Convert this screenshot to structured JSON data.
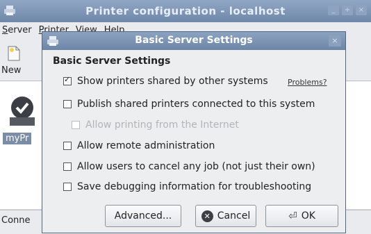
{
  "background_window": {
    "title": "Printer configuration - localhost",
    "menu": [
      "Server",
      "Printer",
      "View",
      "Help"
    ],
    "toolbar_new": "New",
    "printer_label": "myPr",
    "status": "Conne",
    "window_buttons": [
      "_",
      "+",
      "×"
    ]
  },
  "dialog": {
    "title": "Basic Server Settings",
    "close": "×",
    "heading": "Basic Server Settings",
    "options": {
      "show_shared": {
        "label": "Show printers shared by other systems",
        "checked": true
      },
      "publish": {
        "label": "Publish shared printers connected to this system",
        "checked": false
      },
      "allow_internet": {
        "label": "Allow printing from the Internet",
        "checked": false,
        "disabled": true
      },
      "remote_admin": {
        "label": "Allow remote administration",
        "checked": false
      },
      "cancel_any": {
        "label": "Allow users to cancel any job (not just their own)",
        "checked": false
      },
      "debug": {
        "label": "Save debugging information for troubleshooting",
        "checked": false
      }
    },
    "problems_link": "Problems?",
    "buttons": {
      "advanced": "Advanced...",
      "cancel": "Cancel",
      "ok": "OK"
    }
  },
  "colors": {
    "titlebar": "#7088a9",
    "dialog_bg": "#edeef0",
    "content_bg": "#ffffff"
  }
}
